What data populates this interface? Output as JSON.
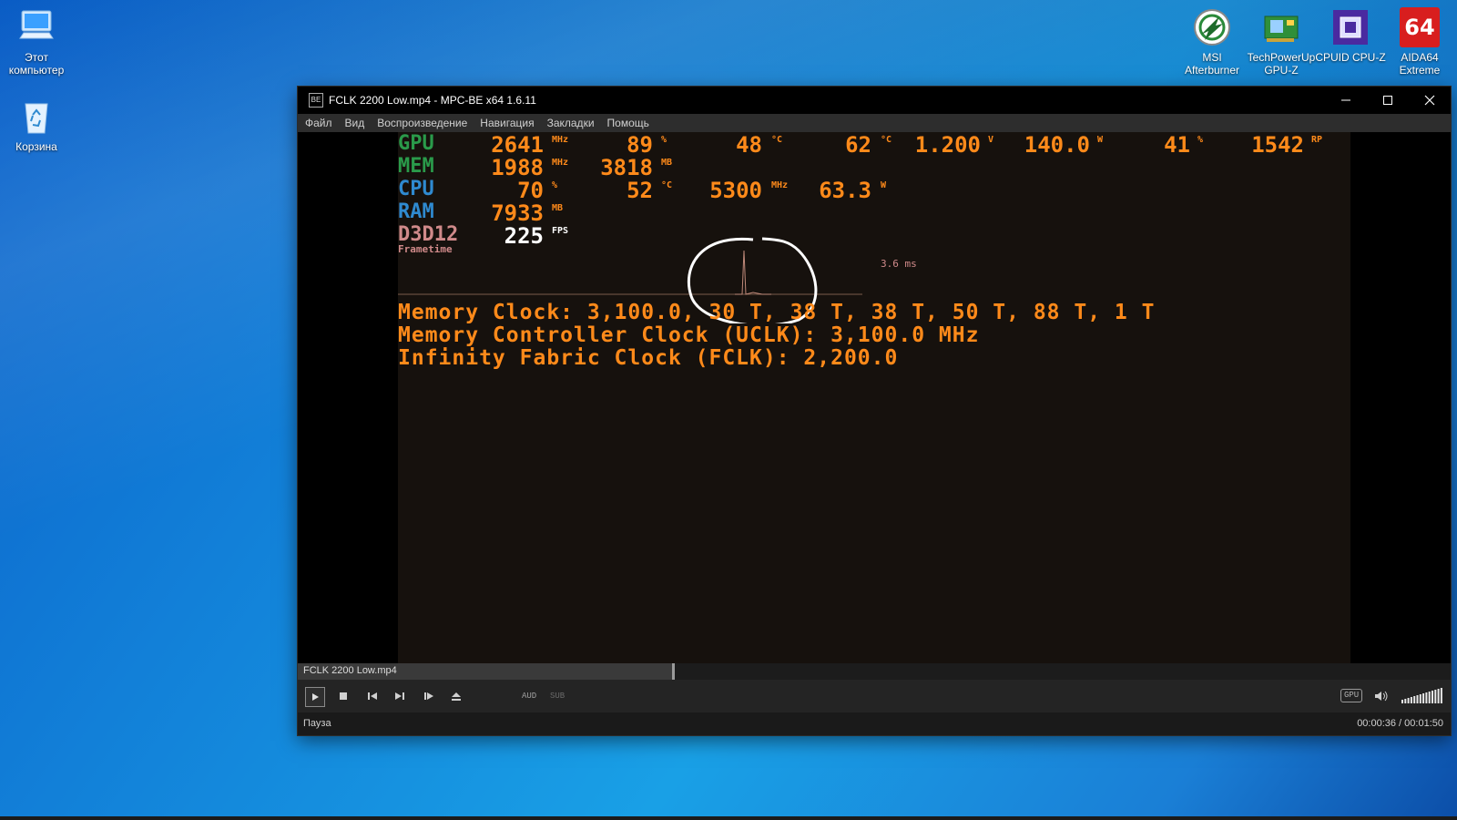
{
  "desktop": {
    "left_icons": [
      {
        "label": "Этот компьютер",
        "icon": "computer-icon"
      },
      {
        "label": "Корзина",
        "icon": "recycle-bin-icon"
      }
    ],
    "right_icons": [
      {
        "label": "MSI Afterburner",
        "icon": "afterburner-icon"
      },
      {
        "label": "TechPowerUp GPU-Z",
        "icon": "gpuz-icon"
      },
      {
        "label": "CPUID CPU-Z",
        "icon": "cpuz-icon"
      },
      {
        "label": "AIDA64 Extreme",
        "icon": "aida64-icon",
        "badge": "64"
      }
    ]
  },
  "window": {
    "title": "FCLK 2200 Low.mp4 - MPC-BE x64 1.6.11",
    "app_icon_text": "BE",
    "menu": [
      "Файл",
      "Вид",
      "Воспроизведение",
      "Навигация",
      "Закладки",
      "Помощь"
    ]
  },
  "osd": {
    "gpu": {
      "label": "GPU",
      "clock": "2641",
      "clock_unit": "MHz",
      "usage": "89",
      "usage_unit": "%",
      "temp": "48",
      "temp_unit": "°C",
      "hotspot": "62",
      "hotspot_unit": "°C",
      "voltage": "1.200",
      "voltage_unit": "V",
      "power": "140.0",
      "power_unit": "W",
      "fan": "41",
      "fan_unit": "%",
      "rpm": "1542",
      "rpm_unit": "RP"
    },
    "mem": {
      "label": "MEM",
      "clock": "1988",
      "clock_unit": "MHz",
      "used": "3818",
      "used_unit": "MB"
    },
    "cpu": {
      "label": "CPU",
      "usage": "70",
      "usage_unit": "%",
      "temp": "52",
      "temp_unit": "°C",
      "clock": "5300",
      "clock_unit": "MHz",
      "power": "63.3",
      "power_unit": "W"
    },
    "ram": {
      "label": "RAM",
      "used": "7933",
      "used_unit": "MB"
    },
    "api": {
      "label": "D3D12",
      "fps": "225",
      "fps_unit": "FPS"
    },
    "frametime_label": "Frametime",
    "frametime_value": "3.6 ms",
    "lines": [
      "Memory Clock: 3,100.0, 30 T, 38 T, 38 T, 50 T, 88 T, 1 T",
      "Memory Controller Clock (UCLK): 3,100.0 MHz",
      "Infinity Fabric Clock (FCLK): 2,200.0"
    ]
  },
  "player": {
    "filename": "FCLK 2200 Low.mp4",
    "progress": 0.327,
    "aud_label": "AUD",
    "sub_label": "SUB",
    "gpu_label": "GPU",
    "status": "Пауза",
    "time": "00:00:36 / 00:01:50",
    "volume_level": 1.0
  },
  "colors": {
    "gpu_label": "#2a9a4a",
    "mem_label": "#2a9a4a",
    "cpu_label": "#2f8ad0",
    "ram_label": "#2f8ad0",
    "api_label": "#d08a8a",
    "value": "#ff8a1a",
    "fps_value": "#ffffff"
  }
}
